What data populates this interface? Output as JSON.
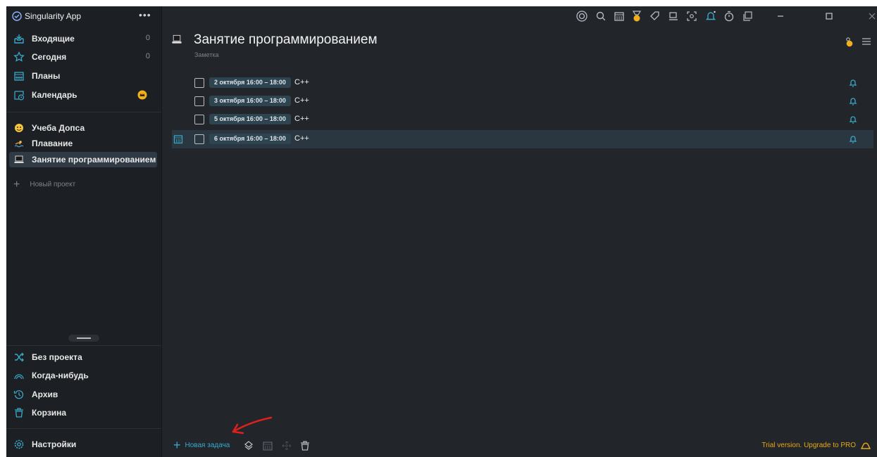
{
  "app": {
    "title": "Singularity App",
    "more": "•••"
  },
  "sidebar": {
    "top_items": [
      {
        "label": "Входящие",
        "count": "0",
        "icon": "inbox-icon"
      },
      {
        "label": "Сегодня",
        "count": "0",
        "icon": "star-icon"
      },
      {
        "label": "Планы",
        "count": "",
        "icon": "calendar-grid-icon"
      },
      {
        "label": "Календарь",
        "count": "",
        "icon": "calendar-clock-icon"
      }
    ],
    "projects": [
      {
        "label": "Учеба Допса",
        "icon": "emoji-face-icon"
      },
      {
        "label": "Плавание",
        "icon": "swimmer-icon"
      },
      {
        "label": "Занятие программированием",
        "icon": "laptop-icon"
      }
    ],
    "new_project": "Новый проект",
    "bottom_items": [
      {
        "label": "Без проекта",
        "icon": "shuffle-icon"
      },
      {
        "label": "Когда-нибудь",
        "icon": "rainbow-icon"
      },
      {
        "label": "Архив",
        "icon": "history-icon"
      },
      {
        "label": "Корзина",
        "icon": "trash-icon"
      }
    ],
    "settings": "Настройки"
  },
  "main": {
    "title": "Занятие программированием",
    "subtitle": "Заметка",
    "tasks": [
      {
        "date": "2 октября 16:00 – 18:00",
        "name": "C++"
      },
      {
        "date": "3 октября 16:00 – 18:00",
        "name": "C++"
      },
      {
        "date": "5 октября 16:00 – 18:00",
        "name": "C++"
      },
      {
        "date": "6 октября 16:00 – 18:00",
        "name": "C++"
      }
    ]
  },
  "bottom": {
    "new_task": "Новая задача",
    "trial": "Trial version. Upgrade to PRO"
  },
  "colors": {
    "accent": "#3aa8c8",
    "pro": "#e6a817",
    "bg": "#22262b",
    "sidebar": "#1c1f24"
  }
}
